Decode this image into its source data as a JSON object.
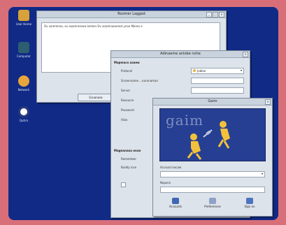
{
  "desktop": {
    "icons": [
      {
        "label": "User Home"
      },
      {
        "label": "Computer"
      },
      {
        "label": "Network"
      },
      {
        "label": "Qutim"
      }
    ]
  },
  "log_window": {
    "title": "Roomer Lagged",
    "line": "Ov sommiree, ov exomreerwe lemlen  Ov anamnaeemot ynoe  Moreo  e"
  },
  "account_window": {
    "title": "Adinaeme anlobe nohe",
    "section_account": "Mapmacs asaew",
    "label_protocol": "Protocol",
    "protocol_value": "Jabber",
    "label_screen": "Screenname ...ouronaman",
    "label_server": "Server",
    "label_resource": "Resource",
    "label_password": "Password",
    "label_alias": "Alias",
    "section_options": "Magnanaxa onan",
    "label_remember": "Remember",
    "label_buddy": "Buddy icon"
  },
  "log_button": "Gruanosa",
  "gaim_window": {
    "title": "Gaim",
    "splash_word": "gaim",
    "label_account": "Account eacaw",
    "label_password": "Napons",
    "buttons": [
      {
        "label": "Accounts"
      },
      {
        "label": "Preferences"
      },
      {
        "label": "Sign on"
      }
    ]
  }
}
